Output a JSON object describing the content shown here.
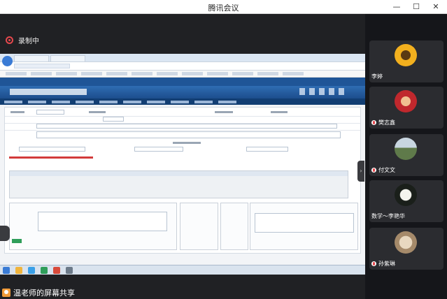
{
  "window": {
    "title": "腾讯会议"
  },
  "recording": {
    "label": "录制中"
  },
  "share": {
    "label": "温老师的屏幕共享"
  },
  "participants": [
    {
      "name": "李婷",
      "avatar": "sunflower"
    },
    {
      "name": "樊志鑫",
      "avatar": "red-portrait"
    },
    {
      "name": "付文文",
      "avatar": "landscape"
    },
    {
      "name": "数学～李艳华",
      "avatar": "white-lily"
    },
    {
      "name": "孙紫琳",
      "avatar": "cat"
    }
  ],
  "colors": {
    "accent": "#1f5597",
    "record": "#e5484d",
    "share": "#f29b38"
  }
}
